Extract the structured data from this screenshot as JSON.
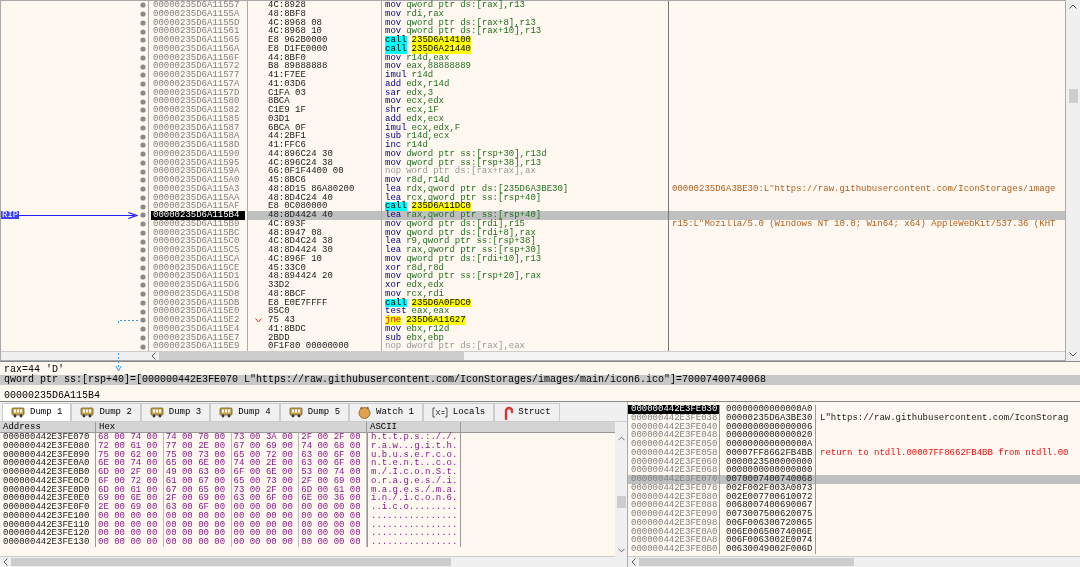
{
  "disassembly": {
    "rows": [
      {
        "address": "00000235D6A11557",
        "bytes": "4C:8928",
        "mnemonic": "mov",
        "operands": "qword ptr ds:[rax],r13",
        "kind": "normal",
        "selected": false
      },
      {
        "address": "00000235D6A1155A",
        "bytes": "48:8BF8",
        "mnemonic": "mov",
        "operands": "rdi,rax",
        "kind": "normal",
        "selected": false
      },
      {
        "address": "00000235D6A1155D",
        "bytes": "4C:8968 08",
        "mnemonic": "mov",
        "operands": "qword ptr ds:[rax+8],r13",
        "kind": "normal",
        "selected": false
      },
      {
        "address": "00000235D6A11561",
        "bytes": "4C:8968 10",
        "mnemonic": "mov",
        "operands": "qword ptr ds:[rax+10],r13",
        "kind": "normal",
        "selected": false
      },
      {
        "address": "00000235D6A11565",
        "bytes": "E8 962B0000",
        "mnemonic": "call",
        "operands": "235D6A14100",
        "kind": "call",
        "selected": false
      },
      {
        "address": "00000235D6A1156A",
        "bytes": "E8 D1FE0000",
        "mnemonic": "call",
        "operands": "235D6A21440",
        "kind": "call",
        "selected": false
      },
      {
        "address": "00000235D6A1156F",
        "bytes": "44:8BF0",
        "mnemonic": "mov",
        "operands": "r14d,eax",
        "kind": "normal",
        "selected": false
      },
      {
        "address": "00000235D6A11572",
        "bytes": "B8 89888888",
        "mnemonic": "mov",
        "operands": "eax,88888889",
        "kind": "normal",
        "selected": false
      },
      {
        "address": "00000235D6A11577",
        "bytes": "41:F7EE",
        "mnemonic": "imul",
        "operands": "r14d",
        "kind": "normal",
        "selected": false
      },
      {
        "address": "00000235D6A1157A",
        "bytes": "41:03D6",
        "mnemonic": "add",
        "operands": "edx,r14d",
        "kind": "normal",
        "selected": false
      },
      {
        "address": "00000235D6A1157D",
        "bytes": "C1FA 03",
        "mnemonic": "sar",
        "operands": "edx,3",
        "kind": "normal",
        "selected": false
      },
      {
        "address": "00000235D6A11580",
        "bytes": "8BCA",
        "mnemonic": "mov",
        "operands": "ecx,edx",
        "kind": "normal",
        "selected": false
      },
      {
        "address": "00000235D6A11582",
        "bytes": "C1E9 1F",
        "mnemonic": "shr",
        "operands": "ecx,1F",
        "kind": "normal",
        "selected": false
      },
      {
        "address": "00000235D6A11585",
        "bytes": "03D1",
        "mnemonic": "add",
        "operands": "edx,ecx",
        "kind": "normal",
        "selected": false
      },
      {
        "address": "00000235D6A11587",
        "bytes": "6BCA 0F",
        "mnemonic": "imul",
        "operands": "ecx,edx,F",
        "kind": "normal",
        "selected": false
      },
      {
        "address": "00000235D6A1158A",
        "bytes": "44:2BF1",
        "mnemonic": "sub",
        "operands": "r14d,ecx",
        "kind": "normal",
        "selected": false
      },
      {
        "address": "00000235D6A1158D",
        "bytes": "41:FFC6",
        "mnemonic": "inc",
        "operands": "r14d",
        "kind": "normal",
        "selected": false
      },
      {
        "address": "00000235D6A11590",
        "bytes": "44:896C24 30",
        "mnemonic": "mov",
        "operands": "dword ptr ss:[rsp+30],r13d",
        "kind": "normal",
        "selected": false
      },
      {
        "address": "00000235D6A11595",
        "bytes": "4C:896C24 38",
        "mnemonic": "mov",
        "operands": "qword ptr ss:[rsp+38],r13",
        "kind": "normal",
        "selected": false
      },
      {
        "address": "00000235D6A1159A",
        "bytes": "66:0F1F4400 00",
        "mnemonic": "nop",
        "operands": "word ptr ds:[rax+rax],ax",
        "kind": "nop",
        "selected": false
      },
      {
        "address": "00000235D6A115A0",
        "bytes": "45:8BC6",
        "mnemonic": "mov",
        "operands": "r8d,r14d",
        "kind": "normal",
        "selected": false
      },
      {
        "address": "00000235D6A115A3",
        "bytes": "48:8D15 86A80200",
        "mnemonic": "lea",
        "operands": "rdx,qword ptr ds:[235D6A3BE30]",
        "kind": "normal",
        "selected": false,
        "comment": "00000235D6A3BE30:L\"https://raw.githubusercontent.com/IconStorages/image"
      },
      {
        "address": "00000235D6A115AA",
        "bytes": "48:8D4C24 40",
        "mnemonic": "lea",
        "operands": "rcx,qword ptr ss:[rsp+40]",
        "kind": "normal",
        "selected": false
      },
      {
        "address": "00000235D6A115AF",
        "bytes": "E8 0C080000",
        "mnemonic": "call",
        "operands": "235D6A11DC0",
        "kind": "call",
        "selected": false
      },
      {
        "address": "00000235D6A115B4",
        "bytes": "48:8D4424 40",
        "mnemonic": "lea",
        "operands": "rax,qword ptr ss:[rsp+40]",
        "kind": "normal",
        "selected": true,
        "label": "RIP"
      },
      {
        "address": "00000235D6A115B9",
        "bytes": "4C:893F",
        "mnemonic": "mov",
        "operands": "qword ptr ds:[rdi],r15",
        "kind": "normal",
        "selected": false,
        "comment": "r15:L\"Mozilla/5.0 (Windows NT 10.0; Win64; x64) AppleWebKit/537.36 (KHT"
      },
      {
        "address": "00000235D6A115BC",
        "bytes": "48:8947 08",
        "mnemonic": "mov",
        "operands": "qword ptr ds:[rdi+8],rax",
        "kind": "normal",
        "selected": false
      },
      {
        "address": "00000235D6A115C0",
        "bytes": "4C:8D4C24 38",
        "mnemonic": "lea",
        "operands": "r9,qword ptr ss:[rsp+38]",
        "kind": "normal",
        "selected": false
      },
      {
        "address": "00000235D6A115C5",
        "bytes": "48:8D4424 30",
        "mnemonic": "lea",
        "operands": "rax,qword ptr ss:[rsp+30]",
        "kind": "normal",
        "selected": false
      },
      {
        "address": "00000235D6A115CA",
        "bytes": "4C:896F 10",
        "mnemonic": "mov",
        "operands": "qword ptr ds:[rdi+10],r13",
        "kind": "normal",
        "selected": false
      },
      {
        "address": "00000235D6A115CE",
        "bytes": "45:33C0",
        "mnemonic": "xor",
        "operands": "r8d,r8d",
        "kind": "normal",
        "selected": false
      },
      {
        "address": "00000235D6A115D1",
        "bytes": "48:894424 20",
        "mnemonic": "mov",
        "operands": "qword ptr ss:[rsp+20],rax",
        "kind": "normal",
        "selected": false
      },
      {
        "address": "00000235D6A115D6",
        "bytes": "33D2",
        "mnemonic": "xor",
        "operands": "edx,edx",
        "kind": "normal",
        "selected": false
      },
      {
        "address": "00000235D6A115D8",
        "bytes": "48:8BCF",
        "mnemonic": "mov",
        "operands": "rcx,rdi",
        "kind": "normal",
        "selected": false
      },
      {
        "address": "00000235D6A115DB",
        "bytes": "E8 E0E7FFFF",
        "mnemonic": "call",
        "operands": "235D6A0FDC0",
        "kind": "call",
        "selected": false
      },
      {
        "address": "00000235D6A115E0",
        "bytes": "85C0",
        "mnemonic": "test",
        "operands": "eax,eax",
        "kind": "normal",
        "selected": false
      },
      {
        "address": "00000235D6A115E2",
        "bytes": "75 43",
        "mnemonic": "jne",
        "operands": "235D6A11627",
        "kind": "jump",
        "selected": false
      },
      {
        "address": "00000235D6A115E4",
        "bytes": "41:8BDC",
        "mnemonic": "mov",
        "operands": "ebx,r12d",
        "kind": "normal",
        "selected": false
      },
      {
        "address": "00000235D6A115E7",
        "bytes": "2BDD",
        "mnemonic": "sub",
        "operands": "ebx,ebp",
        "kind": "normal",
        "selected": false
      },
      {
        "address": "00000235D6A115E9",
        "bytes": "0F1F80 00000000",
        "mnemonic": "nop",
        "operands": "dword ptr ds:[rax],eax",
        "kind": "nop",
        "selected": false
      }
    ]
  },
  "info": {
    "lines": [
      {
        "text": "rax=44 'D'",
        "selected": false
      },
      {
        "text": "qword ptr ss:[rsp+40]=[000000442E3FE070 L\"https://raw.githubusercontent.com/IconStorages/images/main/icon6.ico\"]=70007400740068",
        "selected": true
      }
    ],
    "address": "00000235D6A115B4"
  },
  "tabs": [
    {
      "label": "Dump 1",
      "kind": "dump",
      "selected": true
    },
    {
      "label": "Dump 2",
      "kind": "dump",
      "selected": false
    },
    {
      "label": "Dump 3",
      "kind": "dump",
      "selected": false
    },
    {
      "label": "Dump 4",
      "kind": "dump",
      "selected": false
    },
    {
      "label": "Dump 5",
      "kind": "dump",
      "selected": false
    },
    {
      "label": "Watch 1",
      "kind": "watch",
      "selected": false
    },
    {
      "label": "Locals",
      "kind": "locals",
      "selected": false
    },
    {
      "label": "Struct",
      "kind": "struct",
      "selected": false
    }
  ],
  "dump": {
    "columns": [
      "Address",
      "Hex",
      "ASCII"
    ],
    "rows": [
      {
        "address": "000000442E3FE070",
        "hex": [
          "68 00 74 00",
          "74 00 70 00",
          "73 00 3A 00",
          "2F 00 2F 00"
        ],
        "ascii": "h.t.t.p.s.:././."
      },
      {
        "address": "000000442E3FE080",
        "hex": [
          "72 00 61 00",
          "77 00 2E 00",
          "67 00 69 00",
          "74 00 68 00"
        ],
        "ascii": "r.a.w...g.i.t.h."
      },
      {
        "address": "000000442E3FE090",
        "hex": [
          "75 00 62 00",
          "75 00 73 00",
          "65 00 72 00",
          "63 00 6F 00"
        ],
        "ascii": "u.b.u.s.e.r.c.o."
      },
      {
        "address": "000000442E3FE0A0",
        "hex": [
          "6E 00 74 00",
          "65 00 6E 00",
          "74 00 2E 00",
          "63 00 6F 00"
        ],
        "ascii": "n.t.e.n.t...c.o."
      },
      {
        "address": "000000442E3FE0B0",
        "hex": [
          "6D 00 2F 00",
          "49 00 63 00",
          "6F 00 6E 00",
          "53 00 74 00"
        ],
        "ascii": "m./.I.c.o.n.S.t."
      },
      {
        "address": "000000442E3FE0C0",
        "hex": [
          "6F 00 72 00",
          "61 00 67 00",
          "65 00 73 00",
          "2F 00 69 00"
        ],
        "ascii": "o.r.a.g.e.s./.i."
      },
      {
        "address": "000000442E3FE0D0",
        "hex": [
          "6D 00 61 00",
          "67 00 65 00",
          "73 00 2F 00",
          "6D 00 61 00"
        ],
        "ascii": "m.a.g.e.s./.m.a."
      },
      {
        "address": "000000442E3FE0E0",
        "hex": [
          "69 00 6E 00",
          "2F 00 69 00",
          "63 00 6F 00",
          "6E 00 36 00"
        ],
        "ascii": "i.n./.i.c.o.n.6."
      },
      {
        "address": "000000442E3FE0F0",
        "hex": [
          "2E 00 69 00",
          "63 00 6F 00",
          "00 00 00 00",
          "00 00 00 00"
        ],
        "ascii": "..i.c.o........."
      },
      {
        "address": "000000442E3FE100",
        "hex": [
          "00 00 00 00",
          "00 00 00 00",
          "00 00 00 00",
          "00 00 00 00"
        ],
        "ascii": "................"
      },
      {
        "address": "000000442E3FE110",
        "hex": [
          "00 00 00 00",
          "00 00 00 00",
          "00 00 00 00",
          "00 00 00 00"
        ],
        "ascii": "................"
      },
      {
        "address": "000000442E3FE120",
        "hex": [
          "00 00 00 00",
          "00 00 00 00",
          "00 00 00 00",
          "00 00 00 00"
        ],
        "ascii": "................"
      },
      {
        "address": "000000442E3FE130",
        "hex": [
          "00 00 00 00",
          "00 00 00 00",
          "00 00 00 00",
          "00 00 00 00"
        ],
        "ascii": "................"
      }
    ]
  },
  "stack": {
    "rows": [
      {
        "address": "000000442E3FE030",
        "value": "00000000000000A0",
        "selected": true,
        "highlighted": false
      },
      {
        "address": "000000442E3FE038",
        "value": "00000235D6A3BE30",
        "selected": false,
        "highlighted": false,
        "comment": {
          "text": "L\"https://raw.githubusercontent.com/IconStorag",
          "kind": "string"
        }
      },
      {
        "address": "000000442E3FE040",
        "value": "0000000000000006",
        "selected": false,
        "highlighted": false
      },
      {
        "address": "000000442E3FE048",
        "value": "0000000000000020",
        "selected": false,
        "highlighted": false
      },
      {
        "address": "000000442E3FE050",
        "value": "000000000000000A",
        "selected": false,
        "highlighted": false
      },
      {
        "address": "000000442E3FE058",
        "value": "00007FF8662FB4BB",
        "selected": false,
        "highlighted": false,
        "comment": {
          "text": "return to ntdll.00007FF8662FB4BB from ntdll.00",
          "kind": "return"
        }
      },
      {
        "address": "000000442E3FE060",
        "value": "0000023500000000",
        "selected": false,
        "highlighted": false
      },
      {
        "address": "000000442E3FE068",
        "value": "0000000000000000",
        "selected": false,
        "highlighted": false
      },
      {
        "address": "000000442E3FE070",
        "value": "0070007400740068",
        "selected": false,
        "highlighted": true
      },
      {
        "address": "000000442E3FE078",
        "value": "002F002F003A0073",
        "selected": false,
        "highlighted": false
      },
      {
        "address": "000000442E3FE080",
        "value": "002E007700610072",
        "selected": false,
        "highlighted": false
      },
      {
        "address": "000000442E3FE088",
        "value": "0068007400690067",
        "selected": false,
        "highlighted": false
      },
      {
        "address": "000000442E3FE090",
        "value": "0073007500620075",
        "selected": false,
        "highlighted": false
      },
      {
        "address": "000000442E3FE098",
        "value": "006F006300720065",
        "selected": false,
        "highlighted": false
      },
      {
        "address": "000000442E3FE0A0",
        "value": "006E00650074006E",
        "selected": false,
        "highlighted": false
      },
      {
        "address": "000000442E3FE0A8",
        "value": "006F0063002E0074",
        "selected": false,
        "highlighted": false
      },
      {
        "address": "000000442E3FE0B0",
        "value": "00630049002F006D",
        "selected": false,
        "highlighted": false
      }
    ]
  }
}
